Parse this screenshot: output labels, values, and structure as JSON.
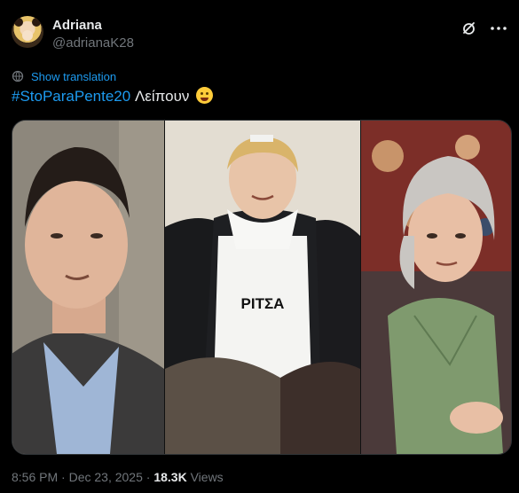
{
  "author": {
    "name": "Adriana",
    "handle": "@adrianaK28"
  },
  "icons": {
    "grok": "grok-icon",
    "more": "more-icon",
    "translate": "globe-icon",
    "emoji": "drooling-face-emoji"
  },
  "translation_link": "Show translation",
  "tweet": {
    "hashtag": "#StoParaPente20",
    "text": "Λείπουν"
  },
  "media": {
    "apron_label": "ΡΙΤΣΑ"
  },
  "meta": {
    "time": "8:56 PM",
    "sep1": "·",
    "date": "Dec 23, 2025",
    "sep2": "·",
    "views_count": "18.3K",
    "views_label": "Views"
  },
  "colors": {
    "background": "#000000",
    "accent": "#1d9bf0",
    "text_primary": "#e7e9ea",
    "text_secondary": "#71767b"
  }
}
